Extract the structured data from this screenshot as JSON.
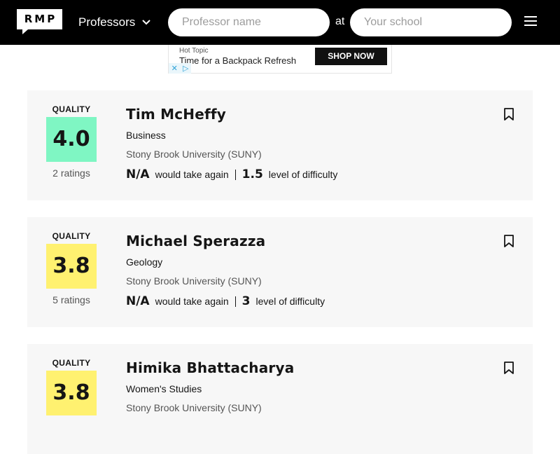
{
  "header": {
    "logo_text": "RMP",
    "search_type_label": "Professors",
    "professor_placeholder": "Professor name",
    "at_label": "at",
    "school_placeholder": "Your school"
  },
  "ad": {
    "brand": "Hot Topic",
    "headline": "Time for a Backpack Refresh",
    "cta": "SHOP NOW"
  },
  "colors": {
    "header_bg": "#000000",
    "quality_high": "#7ff6c3",
    "quality_mid": "#fff170",
    "card_bg": "#f7f7f7"
  },
  "professors": [
    {
      "quality_label": "QUALITY",
      "quality": "4.0",
      "ratings": "2 ratings",
      "name": "Tim McHeffy",
      "department": "Business",
      "school": "Stony Brook University (SUNY)",
      "take_again": "N/A",
      "take_again_label": "would take again",
      "difficulty": "1.5",
      "difficulty_label": "level of difficulty"
    },
    {
      "quality_label": "QUALITY",
      "quality": "3.8",
      "ratings": "5 ratings",
      "name": "Michael Sperazza",
      "department": "Geology",
      "school": "Stony Brook University (SUNY)",
      "take_again": "N/A",
      "take_again_label": "would take again",
      "difficulty": "3",
      "difficulty_label": "level of difficulty"
    },
    {
      "quality_label": "QUALITY",
      "quality": "3.8",
      "name": "Himika Bhattacharya",
      "department": "Women's Studies",
      "school": "Stony Brook University (SUNY)"
    }
  ]
}
